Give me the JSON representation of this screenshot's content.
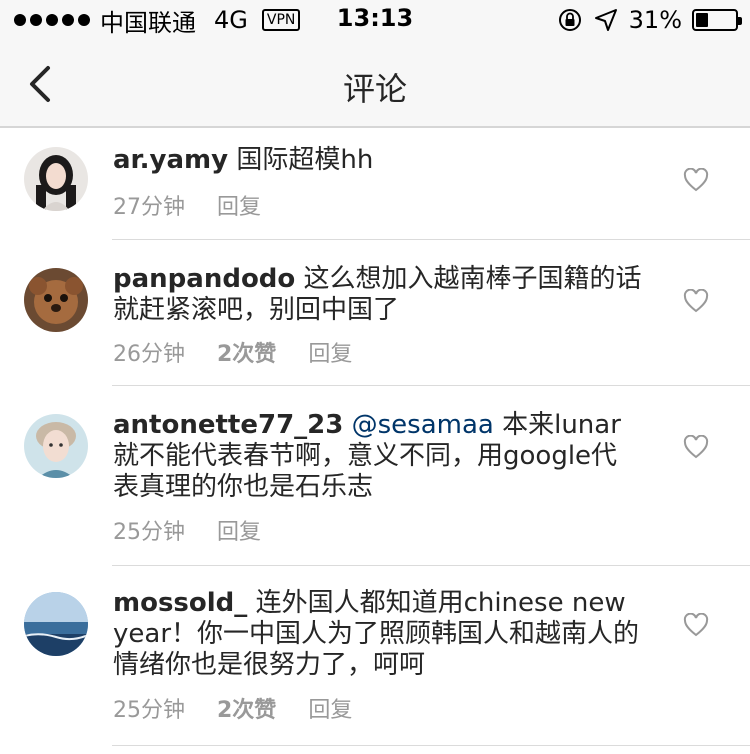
{
  "status_bar": {
    "carrier": "中国联通",
    "network": "4G",
    "vpn": "VPN",
    "time": "13:13",
    "battery": "31%",
    "battery_level": 0.31
  },
  "nav": {
    "title": "评论",
    "back_icon": "chevron-left-icon"
  },
  "comments": [
    {
      "username": "ar.yamy",
      "mention": "",
      "text": "国际超模hh",
      "time": "27分钟",
      "likes": "",
      "reply": "回复"
    },
    {
      "username": "panpandodo",
      "mention": "",
      "text": "这么想加入越南棒子国籍的话就赶紧滚吧，别回中国了",
      "time": "26分钟",
      "likes": "2次赞",
      "reply": "回复"
    },
    {
      "username": "antonette77_23",
      "mention": "@sesamaa",
      "text": "本来lunar就不能代表春节啊，意义不同，用google代表真理的你也是石乐志",
      "time": "25分钟",
      "likes": "",
      "reply": "回复"
    },
    {
      "username": "mossold_",
      "mention": "",
      "text": "连外国人都知道用chinese new year！你一中国人为了照顾韩国人和越南人的情绪你也是很努力了，呵呵",
      "time": "25分钟",
      "likes": "2次赞",
      "reply": "回复"
    }
  ],
  "colors": {
    "username": "#262626",
    "mention": "#003569",
    "meta": "#999999",
    "separator": "#dbdbdb",
    "bar_bg": "#f7f7f7"
  }
}
